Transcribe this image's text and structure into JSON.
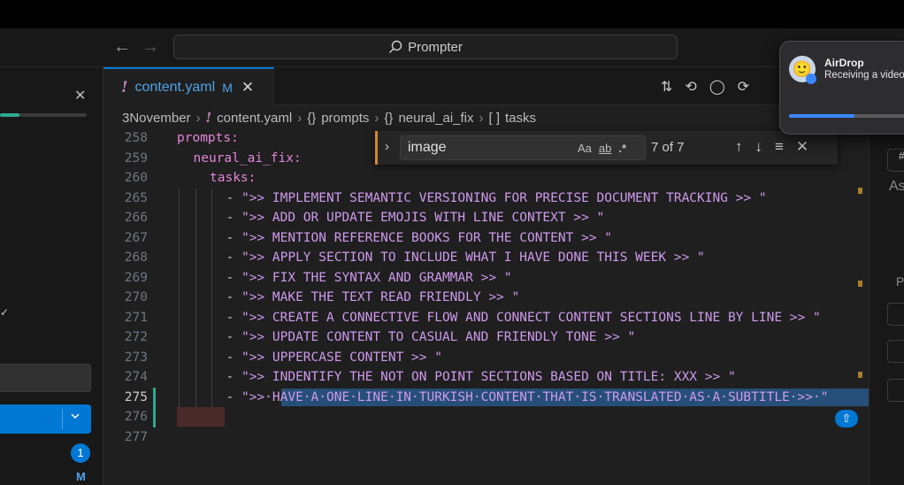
{
  "title_bar": {
    "search_label": "Prompter",
    "back_icon": "arrow-left-icon",
    "forward_icon": "arrow-right-icon"
  },
  "sidebar": {
    "progress_fraction": 0.22,
    "badge_count": "1",
    "modified_marker": "M"
  },
  "tab": {
    "filename": "content.yaml",
    "status": "M"
  },
  "breadcrumb": {
    "folder": "3November",
    "file": "content.yaml",
    "path1": "prompts",
    "path2": "neural_ai_fix",
    "path3": "tasks",
    "object_glyph": "{}",
    "array_glyph": "[ ]"
  },
  "find_widget": {
    "query": "image",
    "match_case": "Aa",
    "whole_word": "ab",
    "regex": ".*",
    "result": "7 of 7"
  },
  "editor": {
    "lines": [
      {
        "num": "258",
        "text": "prompts:",
        "kind": "key",
        "indent": 0
      },
      {
        "num": "259",
        "text": "neural_ai_fix:",
        "kind": "key",
        "indent": 1
      },
      {
        "num": "260",
        "text": "tasks:",
        "kind": "key",
        "indent": 2
      },
      {
        "num": "265",
        "text": "\">> IMPLEMENT SEMANTIC VERSIONING FOR PRECISE DOCUMENT TRACKING >> \"",
        "kind": "item",
        "indent": 3
      },
      {
        "num": "266",
        "text": "\">> ADD OR UPDATE EMOJIS WITH LINE CONTEXT >> \"",
        "kind": "item",
        "indent": 3
      },
      {
        "num": "267",
        "text": "\">> MENTION REFERENCE BOOKS FOR THE CONTENT >> \"",
        "kind": "item",
        "indent": 3
      },
      {
        "num": "268",
        "text": "\">> APPLY SECTION TO INCLUDE WHAT I HAVE DONE THIS WEEK >> \"",
        "kind": "item",
        "indent": 3
      },
      {
        "num": "269",
        "text": "\">> FIX THE SYNTAX AND GRAMMAR >> \"",
        "kind": "item",
        "indent": 3
      },
      {
        "num": "270",
        "text": "\">> MAKE THE TEXT READ FRIENDLY >> \"",
        "kind": "item",
        "indent": 3
      },
      {
        "num": "271",
        "text": "\">> CREATE A CONNECTIVE FLOW AND CONNECT CONTENT SECTIONS LINE BY LINE >> \"",
        "kind": "item",
        "indent": 3
      },
      {
        "num": "272",
        "text": "\">> UPDATE CONTENT TO CASUAL AND FRIENDLY TONE >> \"",
        "kind": "item",
        "indent": 3
      },
      {
        "num": "273",
        "text": "\">> UPPERCASE CONTENT >> \"",
        "kind": "item",
        "indent": 3
      },
      {
        "num": "274",
        "text": "\">> INDENTIFY THE NOT ON POINT SECTIONS BASED ON TITLE: XXX >> \"",
        "kind": "item",
        "indent": 3
      },
      {
        "num": "275",
        "text": "\">>·HAVE·A·ONE·LINE·IN·TURKISH·CONTENT·THAT·IS·TRANSLATED·AS·A·SUBTITLE·>>·\"",
        "kind": "item",
        "indent": 3,
        "selected": true,
        "current": true
      },
      {
        "num": "276",
        "text": "",
        "kind": "empty",
        "indent": 0
      },
      {
        "num": "277",
        "text": "",
        "kind": "empty",
        "indent": 0
      }
    ]
  },
  "right_panel": {
    "as_label": "As",
    "p_label": "P",
    "hash_label": "#"
  },
  "airdrop": {
    "title": "AirDrop",
    "subtitle": "Receiving a video",
    "progress_fraction": 0.53
  }
}
